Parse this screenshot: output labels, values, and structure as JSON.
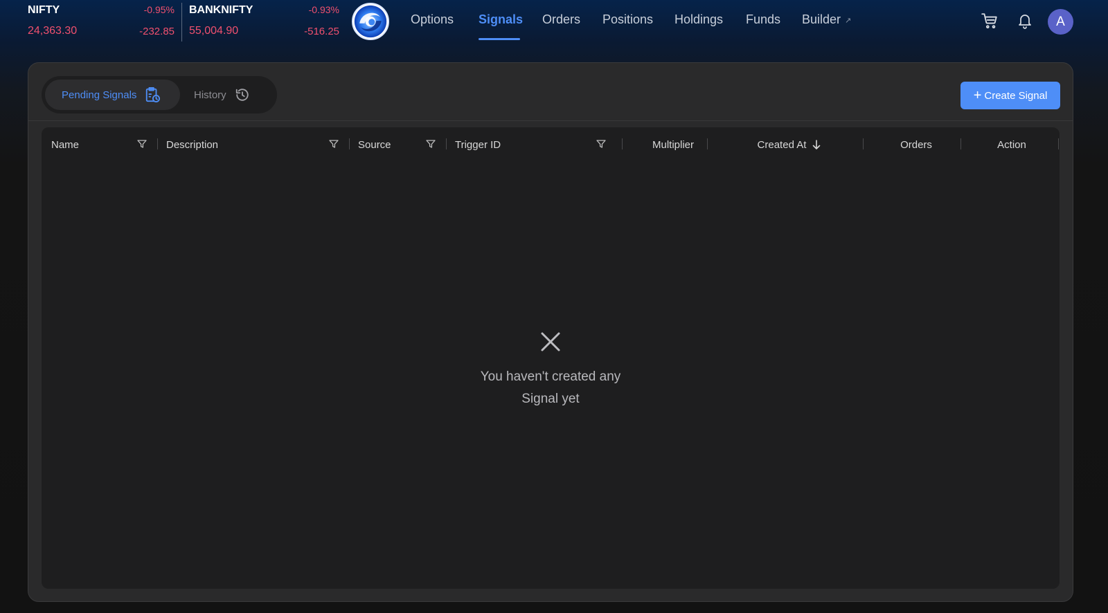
{
  "tickers": [
    {
      "name": "NIFTY",
      "price": "24,363.30",
      "pct": "-0.95%",
      "change": "-232.85"
    },
    {
      "name": "BANKNIFTY",
      "price": "55,004.90",
      "pct": "-0.93%",
      "change": "-516.25"
    }
  ],
  "nav": {
    "items": [
      {
        "label": "Options"
      },
      {
        "label": "Signals",
        "active": true
      },
      {
        "label": "Orders"
      },
      {
        "label": "Positions"
      },
      {
        "label": "Holdings"
      },
      {
        "label": "Funds"
      },
      {
        "label": "Builder",
        "external": true
      }
    ]
  },
  "user": {
    "avatar_initial": "A"
  },
  "tabs": {
    "pending": "Pending Signals",
    "history": "History"
  },
  "create_button": "Create Signal",
  "table": {
    "columns": [
      {
        "label": "Name",
        "filter": true
      },
      {
        "label": "Description",
        "filter": true
      },
      {
        "label": "Source",
        "filter": true
      },
      {
        "label": "Trigger ID",
        "filter": true
      },
      {
        "label": "Multiplier"
      },
      {
        "label": "Created At",
        "sort": "desc"
      },
      {
        "label": "Orders"
      },
      {
        "label": "Action"
      }
    ]
  },
  "empty_state": {
    "line1": "You haven't created any",
    "line2": "Signal yet",
    "icon": "close-icon"
  },
  "colors": {
    "accent": "#4e8ef7",
    "negative": "#f0506e",
    "avatar": "#5a62c8"
  }
}
